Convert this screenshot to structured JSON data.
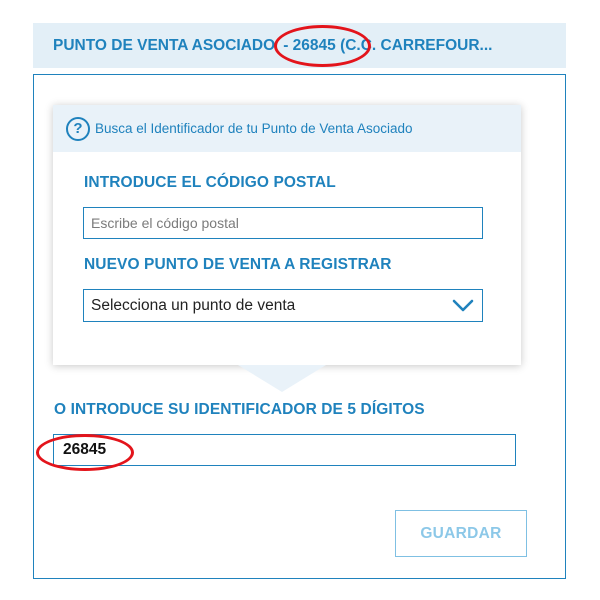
{
  "header": {
    "title": "PUNTO DE VENTA ASOCIADO",
    "code_text": "- 26845 (C.C. CARREFOUR..."
  },
  "search_card": {
    "help_icon": "question-circle-icon",
    "help_text": "Busca el Identificador de tu Punto de Venta Asociado",
    "postal_label": "INTRODUCE EL CÓDIGO POSTAL",
    "postal_placeholder": "Escribe el código postal",
    "postal_value": "",
    "new_pos_label": "NUEVO PUNTO DE VENTA A REGISTRAR",
    "select_value": "Selecciona un punto de venta",
    "select_icon": "chevron-down-icon"
  },
  "identifier": {
    "label": "O INTRODUCE SU IDENTIFICADOR DE 5 DÍGITOS",
    "value": "26845"
  },
  "save_button": {
    "label": "GUARDAR"
  },
  "colors": {
    "accent": "#1f82bd",
    "header_bg": "#e3eff7",
    "annotation": "#e3141b",
    "disabled_button_text": "#8cc8e8"
  }
}
